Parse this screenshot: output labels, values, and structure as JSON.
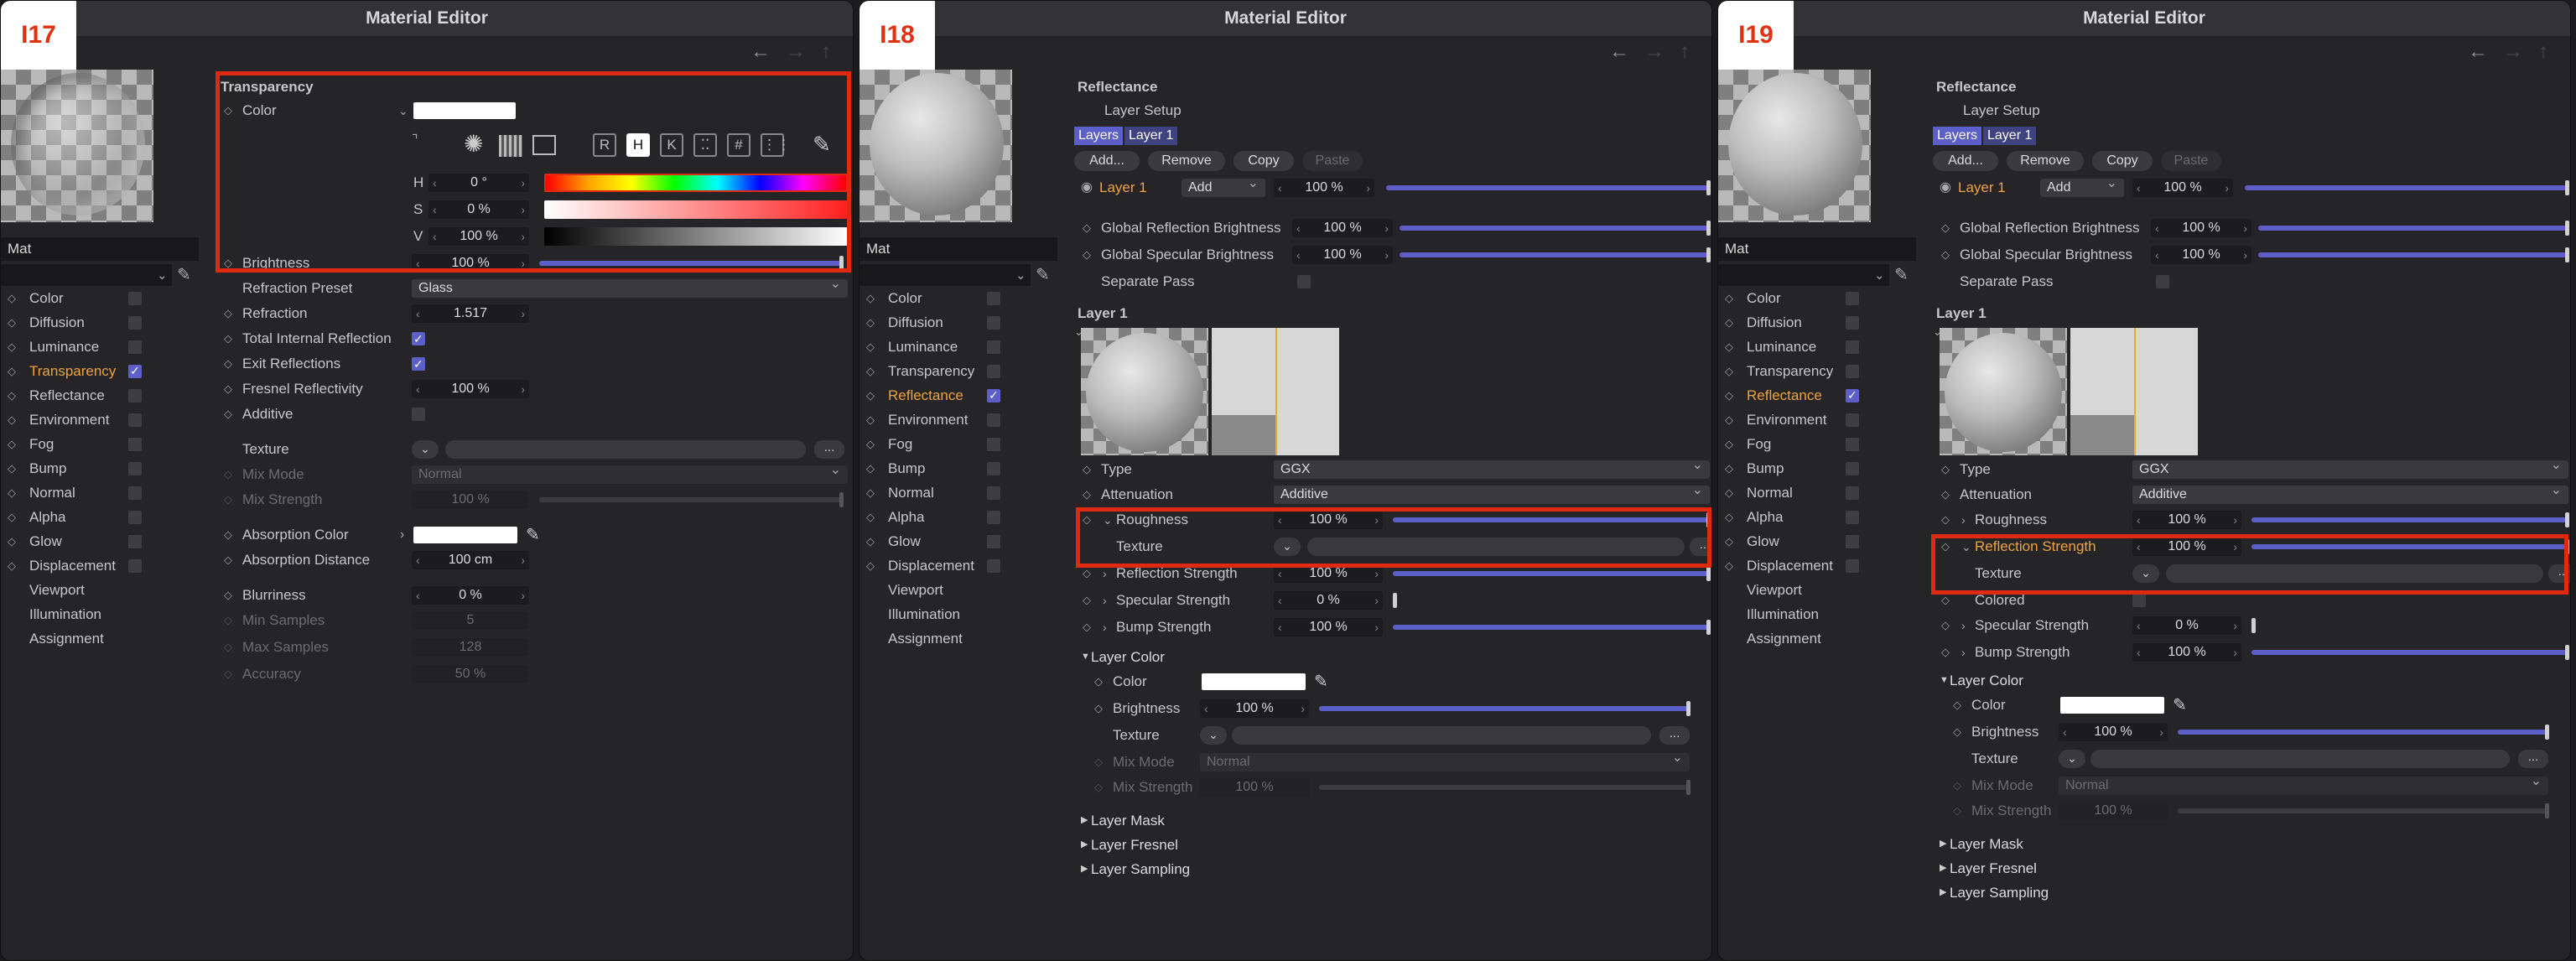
{
  "window_title": "Material Editor",
  "nav": {
    "back": "←",
    "forward": "→",
    "up": "↑"
  },
  "panels": [
    {
      "badge": "I17",
      "material_name": "Mat",
      "channels": [
        {
          "label": "Color",
          "checked": false
        },
        {
          "label": "Diffusion",
          "checked": false
        },
        {
          "label": "Luminance",
          "checked": false
        },
        {
          "label": "Transparency",
          "checked": true,
          "active": true
        },
        {
          "label": "Reflectance",
          "checked": false
        },
        {
          "label": "Environment",
          "checked": false
        },
        {
          "label": "Fog",
          "checked": false
        },
        {
          "label": "Bump",
          "checked": false
        },
        {
          "label": "Normal",
          "checked": false
        },
        {
          "label": "Alpha",
          "checked": false
        },
        {
          "label": "Glow",
          "checked": false
        },
        {
          "label": "Displacement",
          "checked": false
        }
      ],
      "extra_items": [
        "Viewport",
        "Illumination",
        "Assignment"
      ],
      "section_title": "Transparency",
      "color_label": "Color",
      "picker_modes": [
        "R",
        "H",
        "K"
      ],
      "hsv": [
        {
          "label": "H",
          "value": "0 °"
        },
        {
          "label": "S",
          "value": "0 %"
        },
        {
          "label": "V",
          "value": "100 %"
        }
      ],
      "brightness": {
        "label": "Brightness",
        "value": "100 %"
      },
      "refraction_preset": {
        "label": "Refraction Preset",
        "value": "Glass"
      },
      "refraction": {
        "label": "Refraction",
        "value": "1.517"
      },
      "tir": {
        "label": "Total Internal Reflection"
      },
      "exit_reflections": {
        "label": "Exit Reflections"
      },
      "fresnel": {
        "label": "Fresnel Reflectivity",
        "value": "100 %"
      },
      "additive": {
        "label": "Additive"
      },
      "texture": {
        "label": "Texture",
        "more": "..."
      },
      "mix_mode": {
        "label": "Mix Mode",
        "value": "Normal"
      },
      "mix_strength": {
        "label": "Mix Strength",
        "value": "100 %"
      },
      "absorption_color": {
        "label": "Absorption Color"
      },
      "absorption_distance": {
        "label": "Absorption Distance",
        "value": "100 cm"
      },
      "blurriness": {
        "label": "Blurriness",
        "value": "0 %"
      },
      "min_samples": {
        "label": "Min Samples",
        "value": "5"
      },
      "max_samples": {
        "label": "Max Samples",
        "value": "128"
      },
      "accuracy": {
        "label": "Accuracy",
        "value": "50 %"
      }
    },
    {
      "badge": "I18",
      "material_name": "Mat",
      "channels": [
        {
          "label": "Color",
          "checked": false
        },
        {
          "label": "Diffusion",
          "checked": false
        },
        {
          "label": "Luminance",
          "checked": false
        },
        {
          "label": "Transparency",
          "checked": false
        },
        {
          "label": "Reflectance",
          "checked": true,
          "active": true
        },
        {
          "label": "Environment",
          "checked": false
        },
        {
          "label": "Fog",
          "checked": false
        },
        {
          "label": "Bump",
          "checked": false
        },
        {
          "label": "Normal",
          "checked": false
        },
        {
          "label": "Alpha",
          "checked": false
        },
        {
          "label": "Glow",
          "checked": false
        },
        {
          "label": "Displacement",
          "checked": false
        }
      ],
      "extra_items": [
        "Viewport",
        "Illumination",
        "Assignment"
      ],
      "section_title": "Reflectance",
      "layer_setup": "Layer Setup",
      "layers_tab": "Layers",
      "layer1_tab": "Layer 1",
      "buttons": [
        "Add...",
        "Remove",
        "Copy",
        "Paste"
      ],
      "layer_row": {
        "name": "Layer 1",
        "mode": "Add",
        "value": "100 %"
      },
      "global_refl": {
        "label": "Global Reflection Brightness",
        "value": "100 %"
      },
      "global_spec": {
        "label": "Global Specular Brightness",
        "value": "100 %"
      },
      "separate_pass": "Separate Pass",
      "layer_title": "Layer 1",
      "type": {
        "label": "Type",
        "value": "GGX"
      },
      "attenuation": {
        "label": "Attenuation",
        "value": "Additive"
      },
      "roughness": {
        "label": "Roughness",
        "value": "100 %"
      },
      "texture": {
        "label": "Texture",
        "more": "..."
      },
      "reflection_strength": {
        "label": "Reflection Strength",
        "value": "100 %"
      },
      "specular_strength": {
        "label": "Specular Strength",
        "value": "0 %"
      },
      "bump_strength": {
        "label": "Bump Strength",
        "value": "100 %"
      },
      "layer_color": "Layer Color",
      "lc_color": "Color",
      "lc_brightness": {
        "label": "Brightness",
        "value": "100 %"
      },
      "lc_texture": {
        "label": "Texture",
        "more": "..."
      },
      "lc_mix_mode": {
        "label": "Mix Mode",
        "value": "Normal"
      },
      "lc_mix_strength": {
        "label": "Mix Strength",
        "value": "100 %"
      },
      "layer_mask": "Layer Mask",
      "layer_fresnel": "Layer Fresnel",
      "layer_sampling": "Layer Sampling"
    },
    {
      "badge": "I19",
      "material_name": "Mat",
      "channels": [
        {
          "label": "Color",
          "checked": false
        },
        {
          "label": "Diffusion",
          "checked": false
        },
        {
          "label": "Luminance",
          "checked": false
        },
        {
          "label": "Transparency",
          "checked": false
        },
        {
          "label": "Reflectance",
          "checked": true,
          "active": true
        },
        {
          "label": "Environment",
          "checked": false
        },
        {
          "label": "Fog",
          "checked": false
        },
        {
          "label": "Bump",
          "checked": false
        },
        {
          "label": "Normal",
          "checked": false
        },
        {
          "label": "Alpha",
          "checked": false
        },
        {
          "label": "Glow",
          "checked": false
        },
        {
          "label": "Displacement",
          "checked": false
        }
      ],
      "extra_items": [
        "Viewport",
        "Illumination",
        "Assignment"
      ],
      "section_title": "Reflectance",
      "layer_setup": "Layer Setup",
      "layers_tab": "Layers",
      "layer1_tab": "Layer 1",
      "buttons": [
        "Add...",
        "Remove",
        "Copy",
        "Paste"
      ],
      "layer_row": {
        "name": "Layer 1",
        "mode": "Add",
        "value": "100 %"
      },
      "global_refl": {
        "label": "Global Reflection Brightness",
        "value": "100 %"
      },
      "global_spec": {
        "label": "Global Specular Brightness",
        "value": "100 %"
      },
      "separate_pass": "Separate Pass",
      "layer_title": "Layer 1",
      "type": {
        "label": "Type",
        "value": "GGX"
      },
      "attenuation": {
        "label": "Attenuation",
        "value": "Additive"
      },
      "roughness": {
        "label": "Roughness",
        "value": "100 %"
      },
      "reflection_strength": {
        "label": "Reflection Strength",
        "value": "100 %"
      },
      "texture": {
        "label": "Texture",
        "more": "..."
      },
      "colored": "Colored",
      "specular_strength": {
        "label": "Specular Strength",
        "value": "0 %"
      },
      "bump_strength": {
        "label": "Bump Strength",
        "value": "100 %"
      },
      "layer_color": "Layer Color",
      "lc_color": "Color",
      "lc_brightness": {
        "label": "Brightness",
        "value": "100 %"
      },
      "lc_texture": {
        "label": "Texture",
        "more": "..."
      },
      "lc_mix_mode": {
        "label": "Mix Mode",
        "value": "Normal"
      },
      "lc_mix_strength": {
        "label": "Mix Strength",
        "value": "100 %"
      },
      "layer_mask": "Layer Mask",
      "layer_fresnel": "Layer Fresnel",
      "layer_sampling": "Layer Sampling"
    }
  ],
  "colors": {
    "accent": "#5b5fc7",
    "active_text": "#f0a23c",
    "highlight": "#e02a10"
  }
}
